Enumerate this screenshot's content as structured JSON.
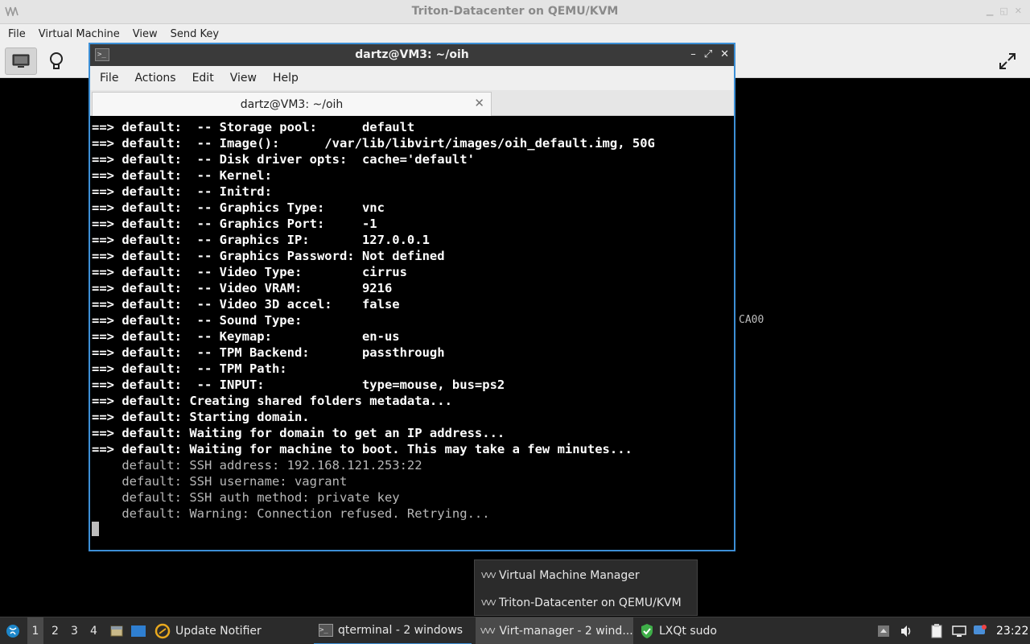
{
  "vm_window": {
    "title": "Triton-Datacenter on QEMU/KVM",
    "menu": [
      "File",
      "Virtual Machine",
      "View",
      "Send Key"
    ],
    "guest_text": "CA00"
  },
  "terminal": {
    "title": "dartz@VM3: ~/oih",
    "menu": [
      "File",
      "Actions",
      "Edit",
      "View",
      "Help"
    ],
    "tab_label": "dartz@VM3: ~/oih",
    "lines": [
      {
        "text": "==> default:  -- Storage pool:      default",
        "style": "b"
      },
      {
        "text": "==> default:  -- Image():      /var/lib/libvirt/images/oih_default.img, 50G",
        "style": "b"
      },
      {
        "text": "==> default:  -- Disk driver opts:  cache='default'",
        "style": "b"
      },
      {
        "text": "==> default:  -- Kernel:",
        "style": "b"
      },
      {
        "text": "==> default:  -- Initrd:",
        "style": "b"
      },
      {
        "text": "==> default:  -- Graphics Type:     vnc",
        "style": "b"
      },
      {
        "text": "==> default:  -- Graphics Port:     -1",
        "style": "b"
      },
      {
        "text": "==> default:  -- Graphics IP:       127.0.0.1",
        "style": "b"
      },
      {
        "text": "==> default:  -- Graphics Password: Not defined",
        "style": "b"
      },
      {
        "text": "==> default:  -- Video Type:        cirrus",
        "style": "b"
      },
      {
        "text": "==> default:  -- Video VRAM:        9216",
        "style": "b"
      },
      {
        "text": "==> default:  -- Video 3D accel:    false",
        "style": "b"
      },
      {
        "text": "==> default:  -- Sound Type:",
        "style": "b"
      },
      {
        "text": "==> default:  -- Keymap:            en-us",
        "style": "b"
      },
      {
        "text": "==> default:  -- TPM Backend:       passthrough",
        "style": "b"
      },
      {
        "text": "==> default:  -- TPM Path:",
        "style": "b"
      },
      {
        "text": "==> default:  -- INPUT:             type=mouse, bus=ps2",
        "style": "b"
      },
      {
        "text": "==> default: Creating shared folders metadata...",
        "style": "b"
      },
      {
        "text": "==> default: Starting domain.",
        "style": "b"
      },
      {
        "text": "==> default: Waiting for domain to get an IP address...",
        "style": "b"
      },
      {
        "text": "==> default: Waiting for machine to boot. This may take a few minutes...",
        "style": "b"
      },
      {
        "text": "    default: SSH address: 192.168.121.253:22",
        "style": "d"
      },
      {
        "text": "    default: SSH username: vagrant",
        "style": "d"
      },
      {
        "text": "    default: SSH auth method: private key",
        "style": "d"
      },
      {
        "text": "    default: Warning: Connection refused. Retrying...",
        "style": "d"
      }
    ]
  },
  "popup": {
    "items": [
      "Virtual Machine Manager",
      "Triton-Datacenter on QEMU/KVM"
    ]
  },
  "taskbar": {
    "desktops": [
      "1",
      "2",
      "3",
      "4"
    ],
    "tasks": {
      "update_notifier": "Update Notifier",
      "qterminal": "qterminal - 2 windows",
      "virt_manager": "Virt-manager - 2 wind...",
      "lxqt_sudo": "LXQt sudo"
    },
    "clock": "23:22"
  },
  "colors": {
    "accent": "#3c8fd6",
    "terminal_bg": "#000000",
    "taskbar_bg": "#2b2b2b"
  }
}
